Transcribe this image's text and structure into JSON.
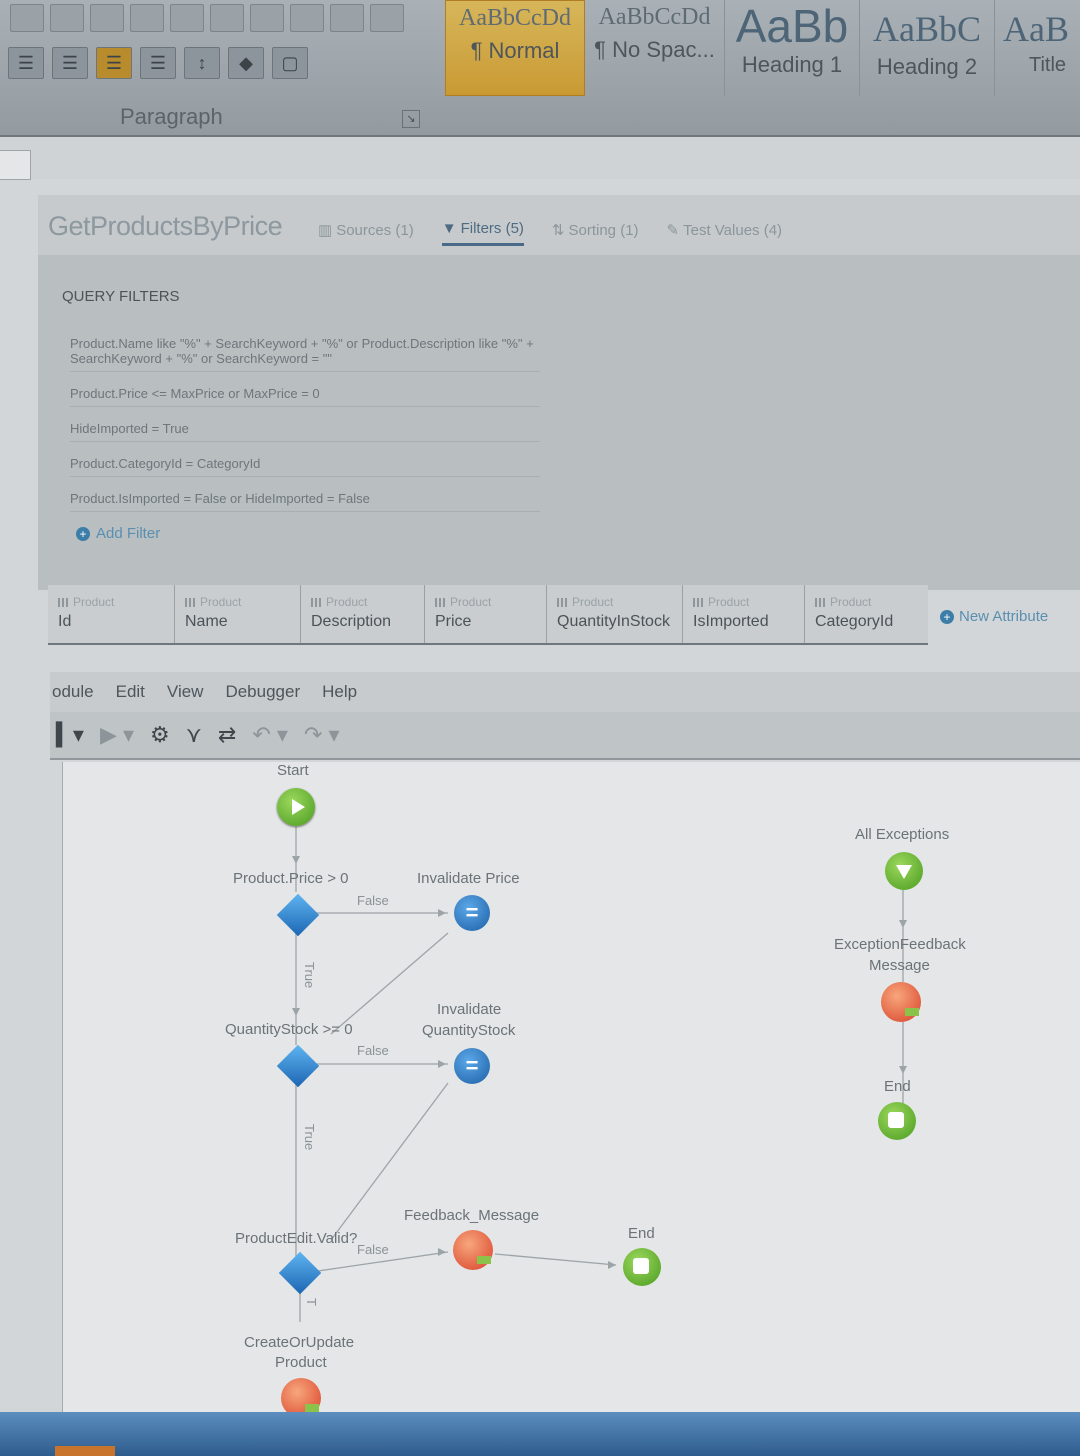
{
  "ribbon": {
    "paragraph_label": "Paragraph",
    "launcher_icon": "dialog-launcher-icon",
    "styles": [
      {
        "sample": "AaBbCcDd",
        "name": "¶ Normal",
        "selected": true
      },
      {
        "sample": "AaBbCcDd",
        "name": "¶ No Spac...",
        "selected": false
      },
      {
        "sample": "AaBb",
        "name": "Heading 1",
        "selected": false
      },
      {
        "sample": "AaBbC",
        "name": "Heading 2",
        "selected": false
      },
      {
        "sample": "AaB",
        "name": "Title",
        "selected": false
      }
    ]
  },
  "query": {
    "title": "GetProductsByPrice",
    "tabs": [
      {
        "label": "Sources (1)",
        "active": false
      },
      {
        "label": "Filters (5)",
        "active": true
      },
      {
        "label": "Sorting (1)",
        "active": false
      },
      {
        "label": "Test Values (4)",
        "active": false
      }
    ],
    "section_title": "QUERY FILTERS",
    "filters": [
      "Product.Name like \"%\" + SearchKeyword + \"%\" or Product.Description like \"%\" + SearchKeyword + \"%\" or SearchKeyword = \"\"",
      "Product.Price <= MaxPrice or MaxPrice = 0",
      "HideImported = True",
      "Product.CategoryId = CategoryId",
      "Product.IsImported = False or HideImported = False"
    ],
    "add_filter": "Add Filter"
  },
  "attributes": {
    "entity": "Product",
    "columns": [
      "Id",
      "Name",
      "Description",
      "Price",
      "QuantityInStock",
      "IsImported",
      "CategoryId"
    ],
    "new_attribute": "New Attribute"
  },
  "studio": {
    "menu": [
      "odule",
      "Edit",
      "View",
      "Debugger",
      "Help"
    ],
    "flow": {
      "start": "Start",
      "if1": "Product.Price > 0",
      "assign1": "Invalidate Price",
      "if2": "QuantityStock >= 0",
      "assign2_line1": "Invalidate",
      "assign2_line2": "QuantityStock",
      "if3": "ProductEdit.Valid?",
      "feedback": "Feedback_Message",
      "end1": "End",
      "create_line1": "CreateOrUpdate",
      "create_line2": "Product",
      "all_exceptions": "All Exceptions",
      "exc_msg_line1": "ExceptionFeedback",
      "exc_msg_line2": "Message",
      "end2": "End",
      "false_label": "False",
      "true_label": "True",
      "t_label": "T"
    }
  },
  "colors": {
    "accent_blue": "#486a88",
    "link_blue": "#5b8fb0",
    "start_green": "#4a9b1f",
    "assign_blue": "#1d5fa5",
    "message_red": "#d8402a",
    "style_selected": "#c99a34"
  }
}
